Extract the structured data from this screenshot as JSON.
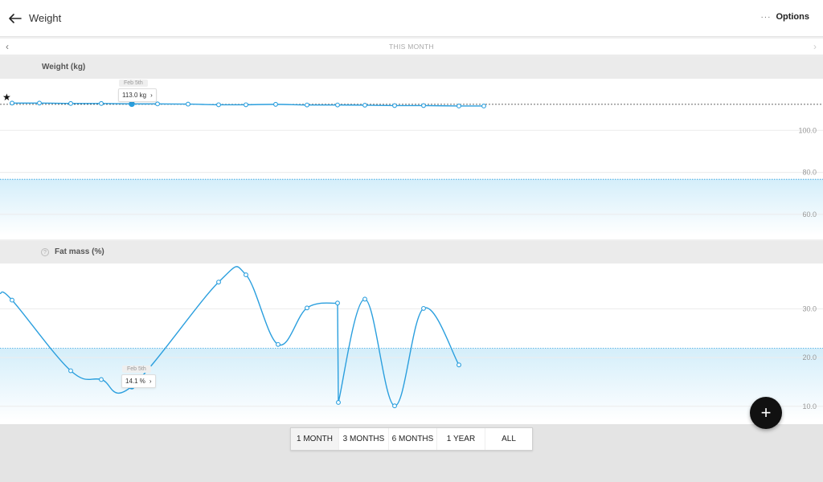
{
  "header": {
    "title": "Weight",
    "options_label": "Options",
    "options_dots": "···"
  },
  "period": {
    "label": "THIS MONTH",
    "prev_glyph": "‹",
    "next_glyph": "›"
  },
  "sections": {
    "weight_title": "Weight (kg)",
    "fat_title": "Fat mass (%)"
  },
  "weight_tooltip": {
    "date": "Feb 5th",
    "value": "113.0 kg",
    "chevron": "›"
  },
  "fat_tooltip": {
    "date": "Feb 5th",
    "value": "14.1 %",
    "chevron": "›"
  },
  "ranges": [
    {
      "label": "1 MONTH",
      "active": true
    },
    {
      "label": "3 MONTHS",
      "active": false
    },
    {
      "label": "6 MONTHS",
      "active": false
    },
    {
      "label": "1 YEAR",
      "active": false
    },
    {
      "label": "ALL",
      "active": false
    }
  ],
  "fab_label": "+",
  "colors": {
    "series": "#2b9fde",
    "band": "#d8f0fb"
  },
  "chart_data": [
    {
      "type": "line",
      "title": "Weight (kg)",
      "ylim": [
        50,
        120
      ],
      "yticks": [
        "100.0",
        "80.0",
        "60.0"
      ],
      "ytick_values": [
        100,
        80,
        60
      ],
      "goal_band": [
        50,
        76.7
      ],
      "reference_line": 112.4,
      "series": [
        {
          "values": [
            113.0,
            113.0,
            112.8,
            112.8,
            112.6,
            112.6,
            112.5,
            112.2,
            112.2,
            112.4,
            112.1,
            112.1,
            112.0,
            111.8,
            111.8,
            111.6,
            111.6
          ]
        }
      ],
      "x": [
        15,
        49,
        88,
        126,
        164,
        196,
        234,
        272,
        306,
        343,
        382,
        420,
        454,
        491,
        527,
        571,
        602
      ],
      "xlim": [
        0,
        1024
      ],
      "tooltip_point_index": 4
    },
    {
      "type": "line",
      "title": "Fat mass (%)",
      "ylim": [
        7,
        38
      ],
      "yticks": [
        "30.0",
        "20.0",
        "10.0"
      ],
      "ytick_values": [
        30,
        20,
        10
      ],
      "goal_band": [
        7,
        21.9
      ],
      "series": [
        {
          "values": [
            33.2,
            31.8,
            17.3,
            15.5,
            14.1,
            35.5,
            37.0,
            22.7,
            30.2,
            31.2,
            10.8,
            32.0,
            10.1,
            30.1,
            18.5
          ]
        }
      ],
      "x": [
        0,
        15,
        88,
        126,
        164,
        272,
        306,
        346,
        382,
        420,
        421,
        454,
        491,
        527,
        571
      ],
      "xlim": [
        0,
        1024
      ],
      "tooltip_point_index": 4,
      "vertical_jump_index": 9
    }
  ]
}
